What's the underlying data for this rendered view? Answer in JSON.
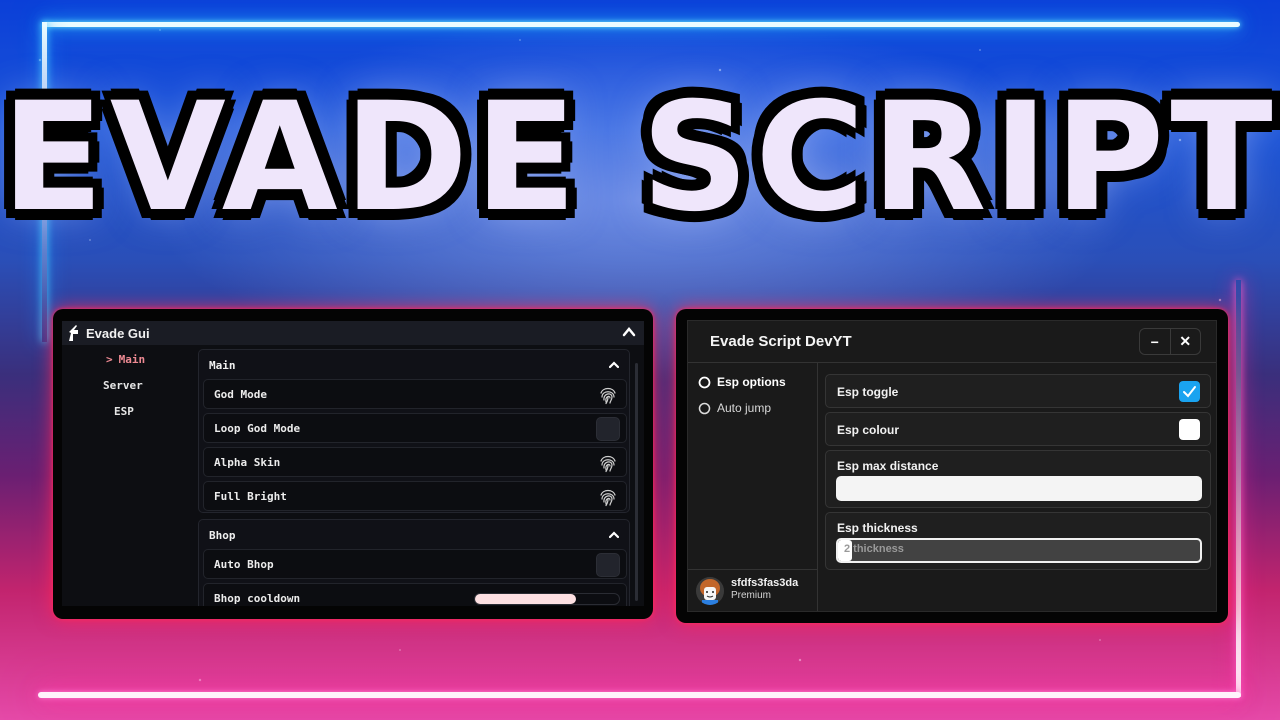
{
  "banner": {
    "title_word1": "EVADE",
    "title_word2": "SCRIPT",
    "colors": {
      "frame_top": "#2cc6ff",
      "frame_bottom": "#ff3aa8",
      "title_fill": "#f2a8e6"
    }
  },
  "evade_gui": {
    "title": "Evade Gui",
    "collapse_icon": "chevron-up-icon",
    "sidebar": [
      {
        "label": "Main",
        "active": true,
        "icon": "chevron-right-icon"
      },
      {
        "label": "Server",
        "active": false
      },
      {
        "label": "ESP",
        "active": false
      }
    ],
    "sections": [
      {
        "title": "Main",
        "rows": [
          {
            "label": "God Mode",
            "control": "fingerprint-icon"
          },
          {
            "label": "Loop God Mode",
            "control": "toggle",
            "checked": false
          },
          {
            "label": "Alpha Skin",
            "control": "fingerprint-icon"
          },
          {
            "label": "Full Bright",
            "control": "fingerprint-icon"
          }
        ]
      },
      {
        "title": "Bhop",
        "rows": [
          {
            "label": "Auto Bhop",
            "control": "toggle",
            "checked": false
          },
          {
            "label": "Bhop cooldown",
            "control": "slider",
            "value_fraction": 0.7
          }
        ]
      }
    ],
    "accent": "#ee8a93"
  },
  "devyt": {
    "title": "Evade Script DevYT",
    "minimize_label": "−",
    "close_label": "✕",
    "tabs": [
      {
        "label": "Esp options",
        "active": true
      },
      {
        "label": "Auto jump",
        "active": false
      }
    ],
    "user": {
      "name": "sfdfs3fas3da",
      "plan": "Premium"
    },
    "options": {
      "esp_toggle": {
        "label": "Esp toggle",
        "checked": true
      },
      "esp_colour": {
        "label": "Esp colour",
        "value": "#ffffff"
      },
      "esp_max_distance": {
        "label": "Esp max distance",
        "value": ""
      },
      "esp_thickness": {
        "label": "Esp thickness",
        "placeholder": "2 thickness",
        "value_fraction": 0.02
      }
    },
    "accent": "#1aa3f0"
  }
}
